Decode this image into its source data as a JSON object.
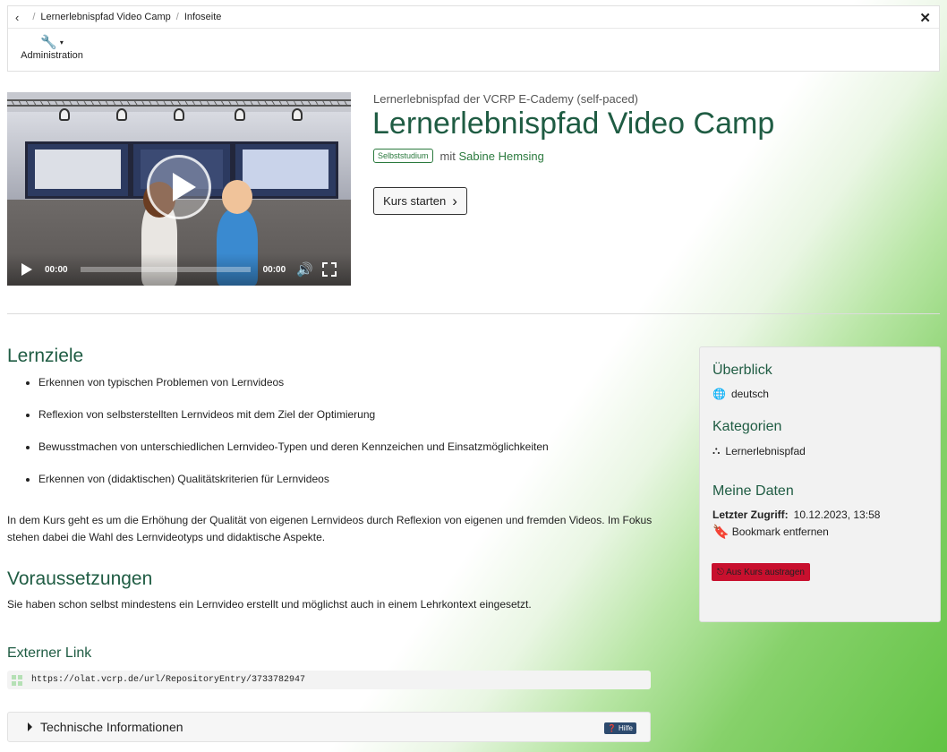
{
  "breadcrumb": {
    "items": [
      "Lernerlebnispfad Video Camp",
      "Infoseite"
    ],
    "separator": "/",
    "back_icon": "‹",
    "close_icon": "✕"
  },
  "toolbar": {
    "admin_label": "Administration",
    "admin_icon": "🔧",
    "caret": "▾"
  },
  "video": {
    "current_time": "00:00",
    "duration": "00:00",
    "volume_icon": "🔊"
  },
  "course": {
    "subtitle": "Lernerlebnispfad der VCRP E-Cademy (self-paced)",
    "title": "Lernerlebnispfad Video Camp",
    "badge": "Selbststudium",
    "author_prefix": "mit",
    "author": "Sabine Hemsing",
    "start_label": "Kurs starten",
    "start_chevron": "›"
  },
  "lernziele": {
    "heading": "Lernziele",
    "items": [
      "Erkennen von typischen Problemen von Lernvideos",
      "Reflexion von selbsterstellten Lernvideos mit dem Ziel der Optimierung",
      "Bewusstmachen von unterschiedlichen Lernvideo-Typen und deren Kennzeichen und Einsatzmöglichkeiten",
      "Erkennen von (didaktischen) Qualitätskriterien für Lernvideos"
    ],
    "description": "In dem Kurs geht es um die Erhöhung der Qualität von eigenen Lernvideos durch Reflexion von eigenen und fremden Videos. Im Fokus stehen dabei die Wahl des Lernvideotyps und didaktische Aspekte."
  },
  "voraussetzungen": {
    "heading": "Voraussetzungen",
    "text": "Sie haben schon selbst mindestens ein Lernvideo erstellt und möglichst auch in einem Lehrkontext eingesetzt."
  },
  "external": {
    "heading": "Externer Link",
    "url": "https://olat.vcrp.de/url/RepositoryEntry/3733782947"
  },
  "tech": {
    "label": "Technische Informationen",
    "help": "❓ Hilfe"
  },
  "sidebar": {
    "overview_heading": "Überblick",
    "language_icon": "🌐",
    "language": "deutsch",
    "categories_heading": "Kategorien",
    "category_icon": "⛬",
    "category": "Lernerlebnispfad",
    "mydata_heading": "Meine Daten",
    "last_access_label": "Letzter Zugriff:",
    "last_access_value": "10.12.2023, 13:58",
    "bookmark_icon": "🔖",
    "bookmark_label": "Bookmark entfernen",
    "leave_label": "⎋ Aus Kurs austragen"
  }
}
